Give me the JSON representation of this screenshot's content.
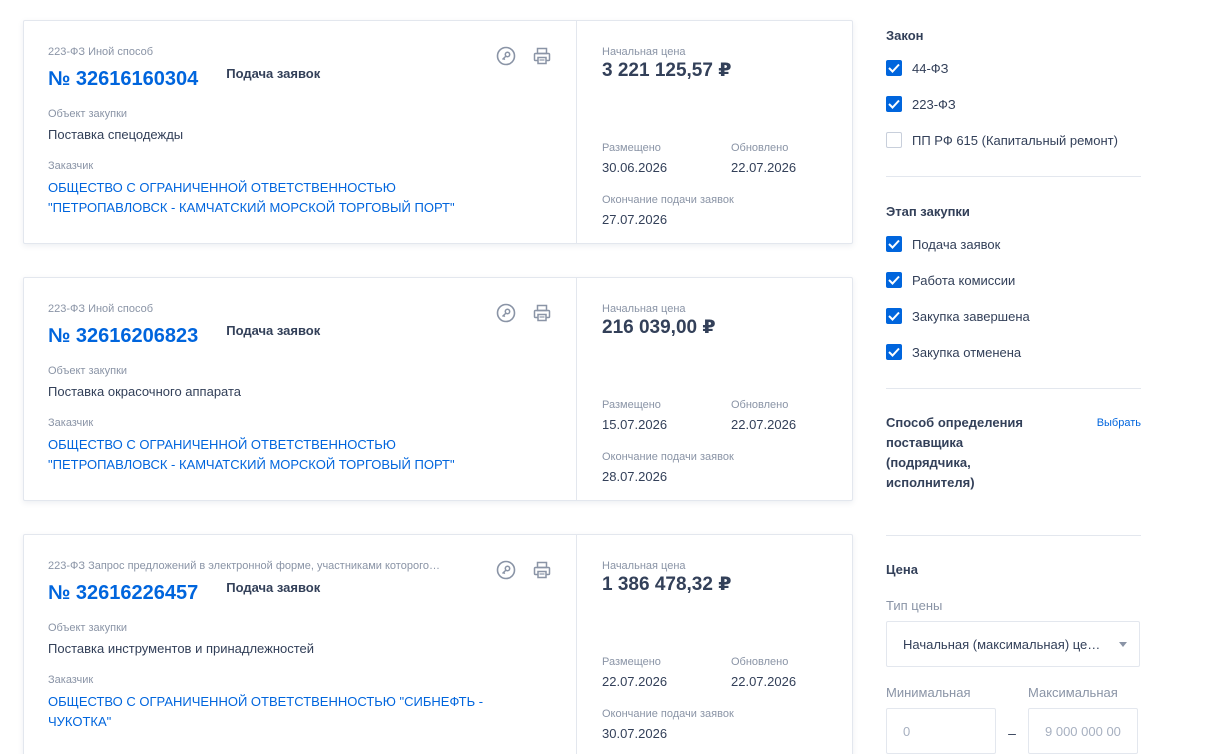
{
  "cards": [
    {
      "law_line": "223-ФЗ Иной способ",
      "reg_number": "№ 32616160304",
      "status": "Подача заявок",
      "object_label": "Объект закупки",
      "object": "Поставка спецодежды",
      "customer_label": "Заказчик",
      "customer": "ОБЩЕСТВО С ОГРАНИЧЕННОЙ ОТВЕТСТВЕННОСТЬЮ \"ПЕТРОПАВЛОВСК - КАМЧАТСКИЙ МОРСКОЙ ТОРГОВЫЙ ПОРТ\"",
      "price_label": "Начальная цена",
      "price": "3 221 125,57 ₽",
      "posted_label": "Размещено",
      "posted": "30.06.2026",
      "updated_label": "Обновлено",
      "updated": "22.07.2026",
      "deadline_label": "Окончание подачи заявок",
      "deadline": "27.07.2026"
    },
    {
      "law_line": "223-ФЗ Иной способ",
      "reg_number": "№ 32616206823",
      "status": "Подача заявок",
      "object_label": "Объект закупки",
      "object": "Поставка окрасочного аппарата",
      "customer_label": "Заказчик",
      "customer": "ОБЩЕСТВО С ОГРАНИЧЕННОЙ ОТВЕТСТВЕННОСТЬЮ \"ПЕТРОПАВЛОВСК - КАМЧАТСКИЙ МОРСКОЙ ТОРГОВЫЙ ПОРТ\"",
      "price_label": "Начальная цена",
      "price": "216 039,00 ₽",
      "posted_label": "Размещено",
      "posted": "15.07.2026",
      "updated_label": "Обновлено",
      "updated": "22.07.2026",
      "deadline_label": "Окончание подачи заявок",
      "deadline": "28.07.2026"
    },
    {
      "law_line": "223-ФЗ Запрос предложений в электронной форме, участниками которого…",
      "reg_number": "№ 32616226457",
      "status": "Подача заявок",
      "object_label": "Объект закупки",
      "object": "Поставка инструментов и принадлежностей",
      "customer_label": "Заказчик",
      "customer": "ОБЩЕСТВО С ОГРАНИЧЕННОЙ ОТВЕТСТВЕННОСТЬЮ \"СИБНЕФТЬ - ЧУКОТКА\"",
      "price_label": "Начальная цена",
      "price": "1 386 478,32 ₽",
      "posted_label": "Размещено",
      "posted": "22.07.2026",
      "updated_label": "Обновлено",
      "updated": "22.07.2026",
      "deadline_label": "Окончание подачи заявок",
      "deadline": "30.07.2026"
    }
  ],
  "icons": {
    "card_left": "key-icon",
    "card_right": "print-icon",
    "checkbox": "check-icon"
  },
  "filters": {
    "law": {
      "title": "Закон",
      "options": [
        {
          "label": "44-ФЗ",
          "checked": true
        },
        {
          "label": "223-ФЗ",
          "checked": true
        },
        {
          "label": "ПП РФ 615 (Капитальный ремонт)",
          "checked": false
        }
      ]
    },
    "stage": {
      "title": "Этап закупки",
      "options": [
        {
          "label": "Подача заявок",
          "checked": true
        },
        {
          "label": "Работа комиссии",
          "checked": true
        },
        {
          "label": "Закупка завершена",
          "checked": true
        },
        {
          "label": "Закупка отменена",
          "checked": true
        }
      ]
    },
    "method": {
      "title": "Способ определения поставщика (подрядчика, исполнителя)",
      "choose": "Выбрать"
    },
    "price": {
      "title": "Цена",
      "type_label": "Тип цены",
      "type_value": "Начальная (максимальная) цена контракта",
      "min_label": "Минимальная",
      "min_placeholder": "0",
      "max_label": "Максимальная",
      "max_placeholder": "9 000 000 000",
      "dash": "–"
    }
  },
  "colors": {
    "accent": "#0065dd",
    "text": "#334059",
    "muted": "#8a94a6",
    "border": "#e3e7ee"
  }
}
